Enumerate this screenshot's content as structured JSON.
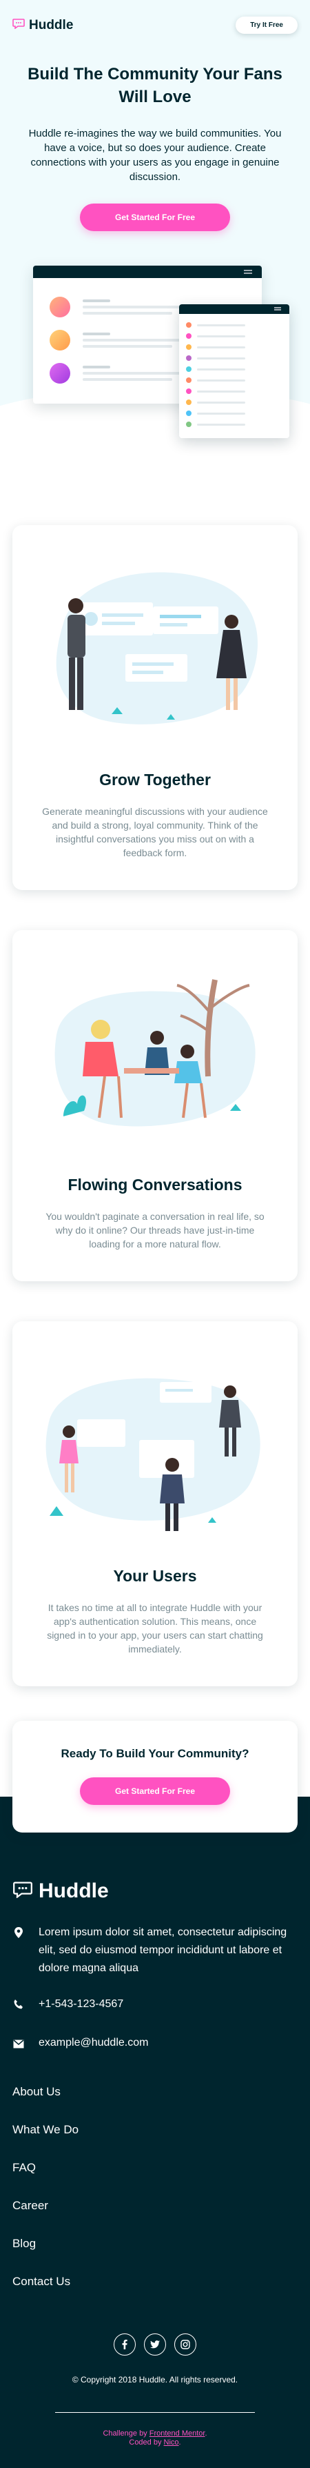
{
  "header": {
    "brand": "Huddle",
    "try_button": "Try It Free"
  },
  "hero": {
    "title": "Build The Community Your Fans Will Love",
    "lead": "Huddle re-imagines the way we build communities. You have a voice, but so does your audience. Create connections with your users as you engage in genuine discussion.",
    "cta": "Get Started For Free"
  },
  "features": [
    {
      "title": "Grow Together",
      "text": "Generate meaningful discussions with your audience and build a strong, loyal community. Think of the insightful conversations you miss out on with a feedback form."
    },
    {
      "title": "Flowing Conversations",
      "text": "You wouldn't paginate a conversation in real life, so why do it online? Our threads have just-in-time loading for a more natural flow."
    },
    {
      "title": "Your Users",
      "text": "It takes no time at all to integrate Huddle with your app's authentication solution. This means, once signed in to your app, your users can start chatting immediately."
    }
  ],
  "ready": {
    "title": "Ready To Build Your Community?",
    "cta": "Get Started For Free"
  },
  "footer": {
    "brand": "Huddle",
    "address": "Lorem ipsum dolor sit amet, consectetur adipiscing elit, sed do eiusmod tempor incididunt ut labore et dolore magna aliqua",
    "phone": "+1-543-123-4567",
    "email": "example@huddle.com",
    "links": [
      "About Us",
      "What We Do",
      "FAQ",
      "Career",
      "Blog",
      "Contact Us"
    ],
    "social_icons": [
      "facebook-icon",
      "twitter-icon",
      "instagram-icon"
    ],
    "copyright": "© Copyright 2018 Huddle. All rights reserved.",
    "attribution": {
      "challenge_prefix": "Challenge by",
      "challenge_link": "Frontend Mentor",
      "coded_prefix": "Coded by",
      "coded_link": "Nico",
      "separator": "."
    }
  },
  "colors": {
    "dark": "#00252e",
    "pink": "#ff52c1",
    "hero_bg": "#f0fbfd",
    "muted_text": "#7a8c93"
  }
}
